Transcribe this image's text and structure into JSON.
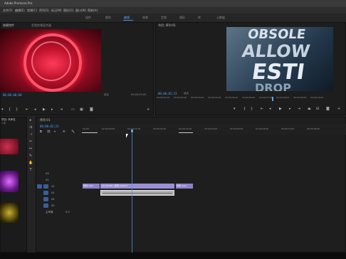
{
  "window": {
    "title": "Adobe Premiere Pro"
  },
  "menu": [
    "文件(F)",
    "编辑(E)",
    "剪辑(C)",
    "序列(S)",
    "标记(M)",
    "图形(G)",
    "窗口(W)",
    "帮助(H)"
  ],
  "workspaces": [
    "组件",
    "编辑",
    "颜色",
    "效果",
    "音频",
    "图形",
    "库",
    "元数据"
  ],
  "active_workspace": "编辑",
  "source_monitor": {
    "tab": "效果控件",
    "tab2": "音频剪辑混合器",
    "fit": "适合",
    "timecode": "00;00;00;00",
    "timecode_right": "00;00;05;00"
  },
  "program_monitor": {
    "tab": "节目: 序列 01",
    "timecode": "00;00;02;23",
    "fit": "适合",
    "preview_text": [
      "OBSOLE",
      "ALLOW",
      "ESTI",
      "DROP"
    ]
  },
  "ruler_ticks": [
    "00;00;01;00",
    "00;00;02;00",
    "00;00;03;00",
    "00;00;04;00",
    "00;00;05;00",
    "00;00;06;00",
    "00;00;07;00",
    "00;00;08;00",
    "00;00;09;00",
    "00;00;10;00"
  ],
  "timeline": {
    "tab": "序列 01",
    "timecode": "00;00;02;23",
    "ruler": [
      "00;00",
      "00;00;00;00",
      "00;00;01;00",
      "00;00;02;00",
      "00;00;03;00",
      "00;00;04;00",
      "00;00;05;00",
      "00;00;06;00",
      "00;00;07;00",
      "00;00;08;00"
    ],
    "tracks": [
      "V3",
      "V2",
      "V1",
      "A1",
      "A2",
      "A3",
      "主声道"
    ],
    "master_value": "0.0",
    "clip_v1_a": "视频.mp4",
    "clip_v1_b": "[V] 20190...视频.mp4[V]",
    "clip_v1_c": "视频.mp4"
  },
  "project": {
    "tab": "项目: 未命名",
    "item_count": "3 项"
  },
  "colors": {
    "accent": "#3c8cff",
    "timecode": "#4da3ff",
    "clip_video": "#8e83c9",
    "clip_audio": "#b6b6b6"
  }
}
